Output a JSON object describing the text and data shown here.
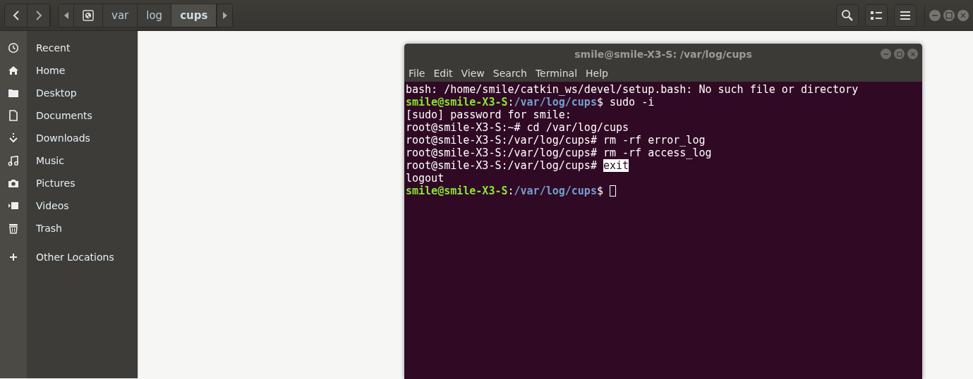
{
  "header": {
    "path": [
      {
        "kind": "disk",
        "selected": false
      },
      {
        "kind": "folder",
        "label": "var",
        "selected": false
      },
      {
        "kind": "folder",
        "label": "log",
        "selected": false
      },
      {
        "kind": "folder",
        "label": "cups",
        "selected": true
      }
    ]
  },
  "sidebar": {
    "items": [
      {
        "label": "Recent"
      },
      {
        "label": "Home"
      },
      {
        "label": "Desktop"
      },
      {
        "label": "Documents"
      },
      {
        "label": "Downloads"
      },
      {
        "label": "Music"
      },
      {
        "label": "Pictures"
      },
      {
        "label": "Videos"
      },
      {
        "label": "Trash"
      },
      {
        "label": "Other Locations"
      }
    ]
  },
  "terminal": {
    "title": "smile@smile-X3-S: /var/log/cups",
    "menu": [
      "File",
      "Edit",
      "View",
      "Search",
      "Terminal",
      "Help"
    ],
    "lines": [
      [
        {
          "kind": "plain",
          "text": "bash: /home/smile/catkin_ws/devel/setup.bash: No such file or directory"
        }
      ],
      [
        {
          "kind": "user",
          "text": "smile@smile-X3-S"
        },
        {
          "kind": "plain",
          "text": ":"
        },
        {
          "kind": "path",
          "text": "/var/log/cups"
        },
        {
          "kind": "plain",
          "text": "$ sudo -i"
        }
      ],
      [
        {
          "kind": "plain",
          "text": "[sudo] password for smile:"
        }
      ],
      [
        {
          "kind": "plain",
          "text": "root@smile-X3-S:~# cd /var/log/cups"
        }
      ],
      [
        {
          "kind": "plain",
          "text": "root@smile-X3-S:/var/log/cups# rm -rf error_log"
        }
      ],
      [
        {
          "kind": "plain",
          "text": "root@smile-X3-S:/var/log/cups# rm -rf access_log"
        }
      ],
      [
        {
          "kind": "plain",
          "text": "root@smile-X3-S:/var/log/cups# "
        },
        {
          "kind": "highlight",
          "text": "exit"
        }
      ],
      [
        {
          "kind": "plain",
          "text": "logout"
        }
      ],
      [
        {
          "kind": "user",
          "text": "smile@smile-X3-S"
        },
        {
          "kind": "plain",
          "text": ":"
        },
        {
          "kind": "path",
          "text": "/var/log/cups"
        },
        {
          "kind": "plain",
          "text": "$ "
        },
        {
          "kind": "cursor"
        }
      ]
    ]
  }
}
